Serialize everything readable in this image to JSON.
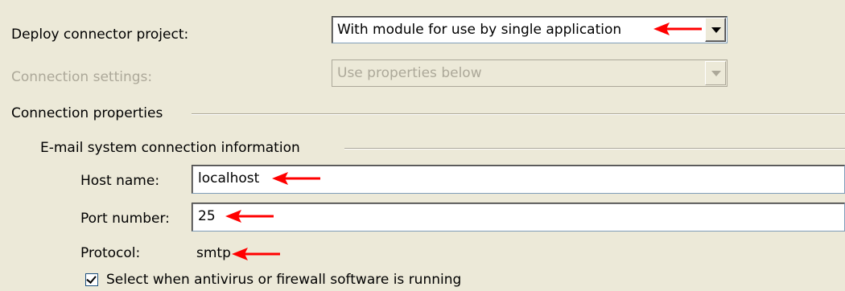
{
  "deploy": {
    "label": "Deploy connector project:",
    "value": "With module for use by single application"
  },
  "connection_settings": {
    "label": "Connection settings:",
    "value": "Use properties below",
    "enabled": false
  },
  "connection_properties": {
    "title": "Connection properties",
    "email_group": {
      "title": "E-mail system connection information",
      "host_label": "Host name:",
      "host_value": "localhost",
      "port_label": "Port number:",
      "port_value": "25",
      "protocol_label": "Protocol:",
      "protocol_value": "smtp",
      "antivirus_label": "Select when antivirus or firewall software is running",
      "antivirus_checked": true
    }
  },
  "colors": {
    "annotation_arrow": "#ff0000"
  },
  "icons": {
    "dropdown": "chevron-down-icon",
    "annotation": "red-arrow-icon",
    "checkbox": "checkmark-icon"
  }
}
